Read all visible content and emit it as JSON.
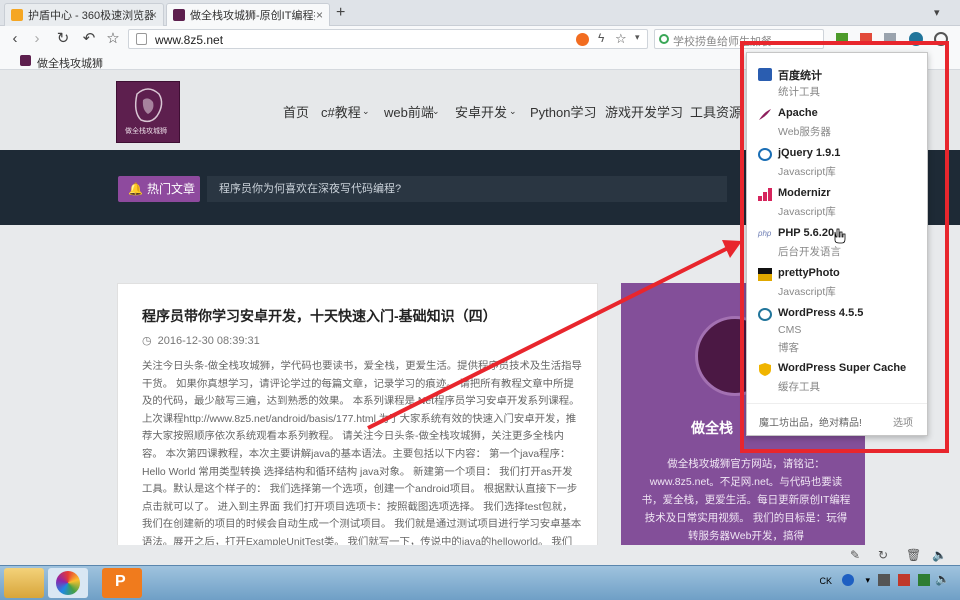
{
  "browser": {
    "tabs": [
      {
        "label": "护盾中心 - 360极速浏览器",
        "active": false
      },
      {
        "label": "做全栈攻城狮-原创IT编程技",
        "active": true
      }
    ],
    "new_tab": "+",
    "url": "www.8z5.net",
    "search_placeholder": "学校捞鱼给师生加餐",
    "bookmark": "做全栈攻城狮"
  },
  "site": {
    "nav": [
      "首页",
      "c#教程",
      "web前端",
      "安卓开发",
      "Python学习",
      "游戏开发学习",
      "工具资源"
    ],
    "hot_label": "热门文章",
    "hot_text": "程序员你为何喜欢在深夜写代码编程?",
    "logo_text": "做全栈攻城狮",
    "article": {
      "title": "程序员带你学习安卓开发，十天快速入门-基础知识（四）",
      "date": "2016-12-30 08:39:31",
      "body": "关注今日头条-做全栈攻城狮，学代码也要读书，爱全栈，更爱生活。提供程序员技术及生活指导干货。 如果你真想学习，请评论学过的每篇文章，记录学习的痕迹。 请把所有教程文章中所提及的代码，最少敲写三遍，达到熟悉的效果。 本系列课程是.Net程序员学习安卓开发系列课程。 上次课程http://www.8z5.net/android/basis/177.html 为了大家系统有效的快速入门安卓开发，推荐大家按照顺序依次系统观看本系列教程。 请关注今日头条-做全栈攻城狮，关注更多全栈内容。 本次第四课教程，本次主要讲解java的基本语法。主要包括以下内容： 第一个java程序：Hello World 常用类型转换 选择结构和循环结构 java对象。 新建第一个项目： 我们打开as开发工具。默认是这个样子的： 我们选择第一个选项，创建一个android项目。 根据默认直接下一步点击就可以了。 进入到主界面 我们打开项目选项卡：按照截图选项选择。 我们选择test包就，我们在创建新的项目的时候会自动生成一个测试项目。 我们就是通过测试项目进行学习安卓基本语法。展开之后，打开ExampleUnitTest类。 我们就写一下，传说中的java的helloworld。 我们在"
    },
    "sidecard": {
      "title": "做全栈",
      "desc": "做全栈攻城狮官方网站，请铭记：www.8z5.net。不足网.net。与代码也要读书，爱全栈，更爱生活。每日更新原创IT编程技术及日常实用视频。 我们的目标是：玩得转服务器Web开发，搞得"
    }
  },
  "popup": {
    "items": [
      {
        "name": "百度统计",
        "category": "统计工具",
        "icon": "baidu-paw-icon",
        "color": "#2a5db0"
      },
      {
        "name": "Apache",
        "category": "Web服务器",
        "icon": "apache-feather-icon",
        "color": "#8e1f5d"
      },
      {
        "name": "jQuery 1.9.1",
        "category": "Javascript库",
        "icon": "jquery-icon",
        "color": "#1a6eb5"
      },
      {
        "name": "Modernizr",
        "category": "Javascript库",
        "icon": "modernizr-icon",
        "color": "#d6245c"
      },
      {
        "name": "PHP 5.6.20",
        "category": "后台开发语言",
        "icon": "php-icon",
        "color": "#6f7fb5"
      },
      {
        "name": "prettyPhoto",
        "category": "Javascript库",
        "icon": "prettyphoto-icon",
        "color": "#e0a800"
      },
      {
        "name": "WordPress 4.5.5",
        "category": "CMS",
        "icon": "wordpress-icon",
        "color": "#21759b"
      },
      {
        "name": "",
        "category": "博客",
        "icon": "",
        "color": ""
      },
      {
        "name": "WordPress Super Cache",
        "category": "缓存工具",
        "icon": "super-cache-icon",
        "color": "#f0b400"
      }
    ],
    "footer_left": "魔工坊出品，绝对精品!",
    "footer_right": "选项"
  },
  "colors": {
    "accent_red": "#e8262d",
    "brand_purple": "#834f99",
    "dark_band": "#1e2a36"
  }
}
